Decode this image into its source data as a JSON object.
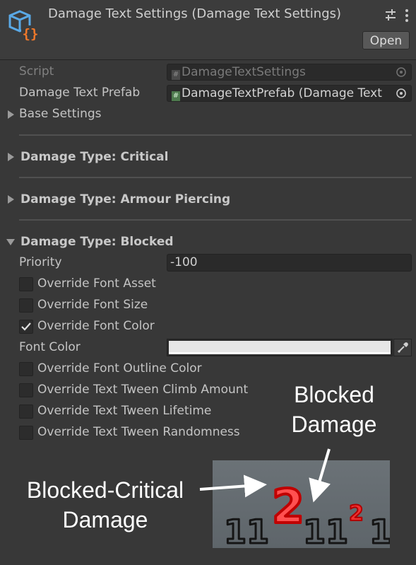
{
  "header": {
    "title": "Damage Text Settings (Damage Text Settings)",
    "open_label": "Open"
  },
  "fields": {
    "script_label": "Script",
    "script_value": "DamageTextSettings",
    "prefab_label": "Damage Text Prefab",
    "prefab_value": "DamageTextPrefab (Damage Text"
  },
  "sections": {
    "base": "Base Settings",
    "critical": "Damage Type: Critical",
    "armour": "Damage Type: Armour Piercing",
    "blocked": "Damage Type: Blocked"
  },
  "blocked": {
    "priority_label": "Priority",
    "priority_value": "-100",
    "font_color_label": "Font Color",
    "font_color": "#e6e6e6",
    "options": [
      {
        "label": "Override Font Asset",
        "checked": false
      },
      {
        "label": "Override Font Size",
        "checked": false
      },
      {
        "label": "Override Font Color",
        "checked": true
      },
      {
        "label": "Override Font Outline Color",
        "checked": false
      },
      {
        "label": "Override Text Tween Climb Amount",
        "checked": false
      },
      {
        "label": "Override Text Tween Lifetime",
        "checked": false
      },
      {
        "label": "Override Text Tween Randomness",
        "checked": false
      }
    ]
  },
  "annotations": {
    "blocked_line1": "Blocked",
    "blocked_line2": "Damage",
    "critical_line1": "Blocked-Critical",
    "critical_line2": "Damage"
  },
  "game_view": {
    "digits": [
      "1",
      "1",
      "2",
      "1",
      "1",
      "2",
      "1"
    ],
    "accent": "#e01010"
  },
  "icons": [
    "script-asset-icon",
    "sliders-icon",
    "kebab-menu-icon",
    "object-picker-icon",
    "eyedropper-icon",
    "checkmark-icon"
  ]
}
